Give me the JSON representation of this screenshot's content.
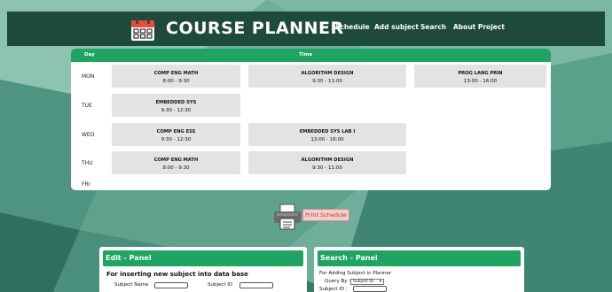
{
  "nav": {
    "brand": "COURSE PLANNER",
    "links": [
      "Schedule",
      "Add subject",
      "Search",
      "About Project"
    ]
  },
  "table": {
    "head_day": "Day",
    "head_time": "Time",
    "days": [
      "MON",
      "TUE",
      "WED",
      "THU",
      "FRI"
    ],
    "rows": [
      [
        {
          "name": "COMP ENG MATH",
          "time": "8:00 - 9:30"
        },
        {
          "name": "ALGORITHM DESIGN",
          "time": "9:30 - 11:00"
        },
        {
          "name": "PROG LANG PRIN",
          "time": "13:00 - 16:00"
        }
      ],
      [
        {
          "name": "EMBEDDED SYS",
          "time": "9:30 - 12:30"
        }
      ],
      [
        {
          "name": "COMP ENG ESS",
          "time": "9:30 - 12:30"
        },
        {
          "name": "EMBEDDED SYS LAB I",
          "time": "13:00 - 16:00"
        }
      ],
      [
        {
          "name": "COMP ENG MATH",
          "time": "8:00 - 9:30"
        },
        {
          "name": "ALGORITHM DESIGN",
          "time": "9:30 - 11:00"
        }
      ],
      []
    ]
  },
  "print_button": "Print Schedule",
  "edit_panel": {
    "title": "Edit - Panel",
    "subtitle": "For inserting new subject into data base",
    "subject_name_label": "Subject Name",
    "subject_id_label": "Subject ID"
  },
  "search_panel": {
    "title": "Search - Panel",
    "desc": "For Adding Subject in Planner",
    "query_label": "Query By :",
    "query_selected": "Subject ID",
    "subject_id_label": "Subject ID :"
  },
  "colors": {
    "navbar": "#1e4a3c",
    "accent": "#1fa463",
    "slot": "#e3e3e3"
  }
}
